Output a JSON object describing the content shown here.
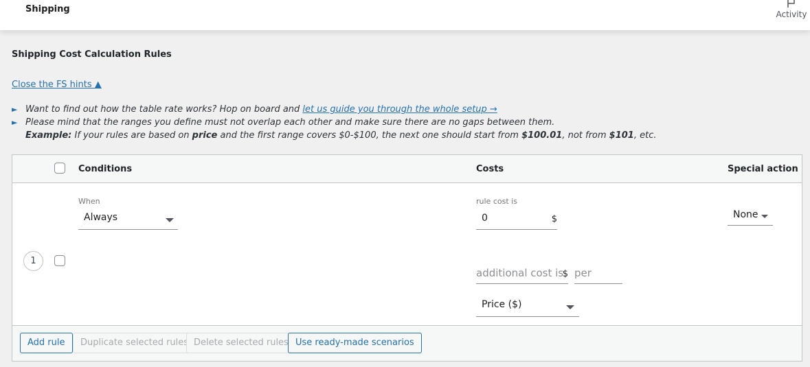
{
  "header": {
    "title": "Shipping",
    "activity_label": "Activity",
    "activity_icon": "flag-icon"
  },
  "section": {
    "title": "Shipping Cost Calculation Rules",
    "hints_toggle": "Close the FS hints ▲"
  },
  "hints": [
    {
      "text": "Want to find out how the table rate works? Hop on board and ",
      "link": "let us guide you through the whole setup →"
    },
    {
      "text": "Please mind that the ranges you define must not overlap each other and make sure there are no gaps between them."
    }
  ],
  "example": {
    "label": "Example:",
    "t1": " If your rules are based on ",
    "b1": "price",
    "t2": " and the first range covers $0-$100, the next one should start from ",
    "b2": "$100.01",
    "t3": ", not from ",
    "b3": "$101",
    "t4": ", etc."
  },
  "table": {
    "columns": {
      "conditions": "Conditions",
      "costs": "Costs",
      "special_action": "Special action"
    },
    "rows": [
      {
        "number": "1",
        "selected": false,
        "when_label": "When",
        "when_value": "Always",
        "rule_cost_label": "rule cost is",
        "rule_cost_value": "0",
        "currency": "$",
        "additional_cost_placeholder": "additional cost is",
        "additional_currency": "$",
        "per_placeholder": "per",
        "per_unit_value": "Price ($)",
        "special_action_value": "None"
      }
    ]
  },
  "footer": {
    "add_rule": "Add rule",
    "duplicate": "Duplicate selected rules",
    "delete": "Delete selected rules",
    "scenarios": "Use ready-made scenarios"
  },
  "colors": {
    "accent": "#2271b1",
    "background": "#f0f0f1",
    "disabled_text": "#a7aaad"
  }
}
